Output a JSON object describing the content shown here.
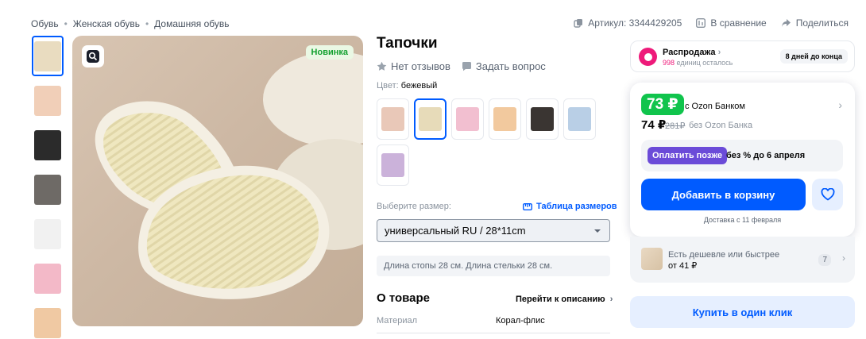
{
  "breadcrumb": {
    "items": [
      "Обувь",
      "Женская обувь",
      "Домашняя обувь"
    ],
    "separator": "•"
  },
  "meta": {
    "article": "Артикул: 3344429205",
    "compare": "В сравнение",
    "share": "Поделиться"
  },
  "gallery": {
    "badge": "Новинка",
    "thumbnail_colors": [
      "#e9dcc0",
      "#f1cfb8",
      "#2b2b2b",
      "#6e6a66",
      "#f1f1f1",
      "#f3b9c8",
      "#f0c9a3"
    ]
  },
  "product": {
    "title": "Тапочки",
    "no_reviews": "Нет отзывов",
    "ask_question": "Задать вопрос",
    "color_label": "Цвет:",
    "color_value": "бежевый",
    "swatch_colors": [
      "#e9c8b8",
      "#e7dbb9",
      "#f2bfd0",
      "#f2c99e",
      "#3a3532",
      "#b9cfe6",
      "#cbb2da"
    ],
    "size_label": "Выберите размер:",
    "size_table": "Таблица размеров",
    "size_selected": "универсальный RU / 28*11cm",
    "length_note": "Длина стопы 28 см. Длина стельки 28 см.",
    "about_title": "О товаре",
    "to_description": "Перейти к описанию",
    "attributes": [
      {
        "key": "Материал",
        "value": "Корал-флис"
      }
    ]
  },
  "sale": {
    "title": "Распродажа",
    "remaining_count": "998",
    "remaining_text": "единиц осталось",
    "days_left": "8 дней до конца"
  },
  "price": {
    "ozon_bank_price": "73 ₽",
    "with_bank": "с Ozon Банком",
    "regular_price": "74 ₽",
    "old_price": "281₽",
    "without_bank": "без Ozon Банка",
    "pay_later_button": "Оплатить позже",
    "pay_later_text": "без % до 6 апреля",
    "add_to_cart": "Добавить в корзину",
    "delivery": "Доставка с 11 февраля"
  },
  "cheaper": {
    "title": "Есть дешевле или быстрее",
    "price": "от 41 ₽",
    "count": "7"
  },
  "one_click": "Купить в один клик",
  "colors": {
    "accent_blue": "#005bff",
    "green_price": "#10c44c",
    "sale_pink": "#ee1a7a",
    "pay_later_purple": "#6b4bd8"
  }
}
